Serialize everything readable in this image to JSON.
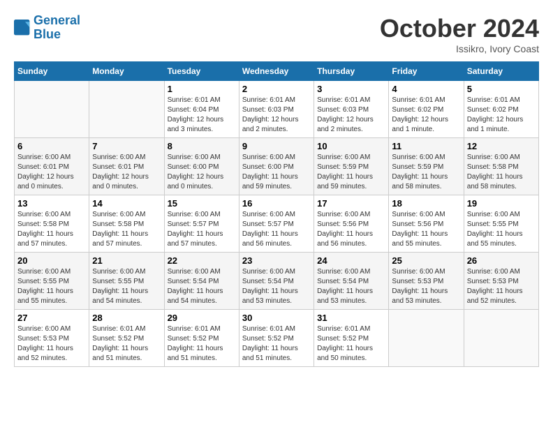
{
  "header": {
    "logo_line1": "General",
    "logo_line2": "Blue",
    "month": "October 2024",
    "location": "Issikro, Ivory Coast"
  },
  "weekdays": [
    "Sunday",
    "Monday",
    "Tuesday",
    "Wednesday",
    "Thursday",
    "Friday",
    "Saturday"
  ],
  "weeks": [
    [
      {
        "day": "",
        "info": ""
      },
      {
        "day": "",
        "info": ""
      },
      {
        "day": "1",
        "info": "Sunrise: 6:01 AM\nSunset: 6:04 PM\nDaylight: 12 hours and 3 minutes."
      },
      {
        "day": "2",
        "info": "Sunrise: 6:01 AM\nSunset: 6:03 PM\nDaylight: 12 hours and 2 minutes."
      },
      {
        "day": "3",
        "info": "Sunrise: 6:01 AM\nSunset: 6:03 PM\nDaylight: 12 hours and 2 minutes."
      },
      {
        "day": "4",
        "info": "Sunrise: 6:01 AM\nSunset: 6:02 PM\nDaylight: 12 hours and 1 minute."
      },
      {
        "day": "5",
        "info": "Sunrise: 6:01 AM\nSunset: 6:02 PM\nDaylight: 12 hours and 1 minute."
      }
    ],
    [
      {
        "day": "6",
        "info": "Sunrise: 6:00 AM\nSunset: 6:01 PM\nDaylight: 12 hours and 0 minutes."
      },
      {
        "day": "7",
        "info": "Sunrise: 6:00 AM\nSunset: 6:01 PM\nDaylight: 12 hours and 0 minutes."
      },
      {
        "day": "8",
        "info": "Sunrise: 6:00 AM\nSunset: 6:00 PM\nDaylight: 12 hours and 0 minutes."
      },
      {
        "day": "9",
        "info": "Sunrise: 6:00 AM\nSunset: 6:00 PM\nDaylight: 11 hours and 59 minutes."
      },
      {
        "day": "10",
        "info": "Sunrise: 6:00 AM\nSunset: 5:59 PM\nDaylight: 11 hours and 59 minutes."
      },
      {
        "day": "11",
        "info": "Sunrise: 6:00 AM\nSunset: 5:59 PM\nDaylight: 11 hours and 58 minutes."
      },
      {
        "day": "12",
        "info": "Sunrise: 6:00 AM\nSunset: 5:58 PM\nDaylight: 11 hours and 58 minutes."
      }
    ],
    [
      {
        "day": "13",
        "info": "Sunrise: 6:00 AM\nSunset: 5:58 PM\nDaylight: 11 hours and 57 minutes."
      },
      {
        "day": "14",
        "info": "Sunrise: 6:00 AM\nSunset: 5:58 PM\nDaylight: 11 hours and 57 minutes."
      },
      {
        "day": "15",
        "info": "Sunrise: 6:00 AM\nSunset: 5:57 PM\nDaylight: 11 hours and 57 minutes."
      },
      {
        "day": "16",
        "info": "Sunrise: 6:00 AM\nSunset: 5:57 PM\nDaylight: 11 hours and 56 minutes."
      },
      {
        "day": "17",
        "info": "Sunrise: 6:00 AM\nSunset: 5:56 PM\nDaylight: 11 hours and 56 minutes."
      },
      {
        "day": "18",
        "info": "Sunrise: 6:00 AM\nSunset: 5:56 PM\nDaylight: 11 hours and 55 minutes."
      },
      {
        "day": "19",
        "info": "Sunrise: 6:00 AM\nSunset: 5:55 PM\nDaylight: 11 hours and 55 minutes."
      }
    ],
    [
      {
        "day": "20",
        "info": "Sunrise: 6:00 AM\nSunset: 5:55 PM\nDaylight: 11 hours and 55 minutes."
      },
      {
        "day": "21",
        "info": "Sunrise: 6:00 AM\nSunset: 5:55 PM\nDaylight: 11 hours and 54 minutes."
      },
      {
        "day": "22",
        "info": "Sunrise: 6:00 AM\nSunset: 5:54 PM\nDaylight: 11 hours and 54 minutes."
      },
      {
        "day": "23",
        "info": "Sunrise: 6:00 AM\nSunset: 5:54 PM\nDaylight: 11 hours and 53 minutes."
      },
      {
        "day": "24",
        "info": "Sunrise: 6:00 AM\nSunset: 5:54 PM\nDaylight: 11 hours and 53 minutes."
      },
      {
        "day": "25",
        "info": "Sunrise: 6:00 AM\nSunset: 5:53 PM\nDaylight: 11 hours and 53 minutes."
      },
      {
        "day": "26",
        "info": "Sunrise: 6:00 AM\nSunset: 5:53 PM\nDaylight: 11 hours and 52 minutes."
      }
    ],
    [
      {
        "day": "27",
        "info": "Sunrise: 6:00 AM\nSunset: 5:53 PM\nDaylight: 11 hours and 52 minutes."
      },
      {
        "day": "28",
        "info": "Sunrise: 6:01 AM\nSunset: 5:52 PM\nDaylight: 11 hours and 51 minutes."
      },
      {
        "day": "29",
        "info": "Sunrise: 6:01 AM\nSunset: 5:52 PM\nDaylight: 11 hours and 51 minutes."
      },
      {
        "day": "30",
        "info": "Sunrise: 6:01 AM\nSunset: 5:52 PM\nDaylight: 11 hours and 51 minutes."
      },
      {
        "day": "31",
        "info": "Sunrise: 6:01 AM\nSunset: 5:52 PM\nDaylight: 11 hours and 50 minutes."
      },
      {
        "day": "",
        "info": ""
      },
      {
        "day": "",
        "info": ""
      }
    ]
  ]
}
